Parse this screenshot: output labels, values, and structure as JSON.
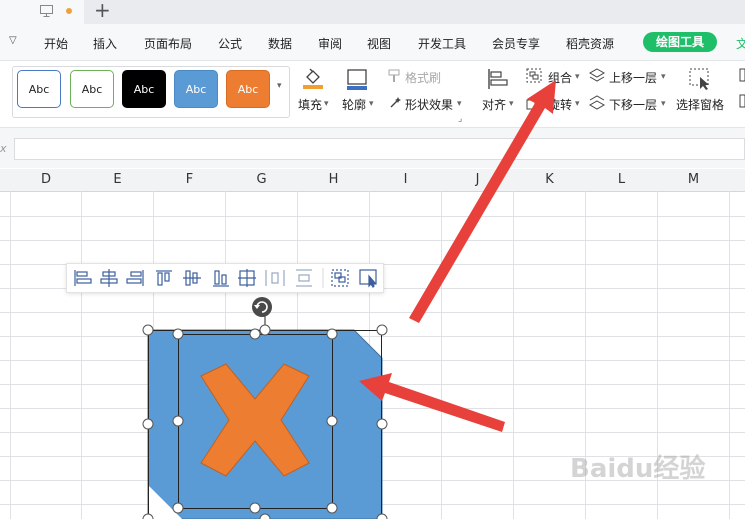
{
  "tabbar": {
    "add_symbol": "+"
  },
  "menu": {
    "tabs": [
      "开始",
      "插入",
      "页面布局",
      "公式",
      "数据",
      "审阅",
      "视图",
      "开发工具",
      "会员专享",
      "稻壳资源"
    ],
    "active_tab": "绘图工具",
    "next_tab_partial": "文"
  },
  "ribbon": {
    "shape_styles": [
      {
        "label": "Abc",
        "fill": "#ffffff",
        "border": "#4a78c2",
        "text": "#222222"
      },
      {
        "label": "Abc",
        "fill": "#ffffff",
        "border": "#6fb05a",
        "text": "#222222"
      },
      {
        "label": "Abc",
        "fill": "#000000",
        "border": "#000000",
        "text": "#ffffff"
      },
      {
        "label": "Abc",
        "fill": "#5b9bd5",
        "border": "#4a8ac4",
        "text": "#ffffff"
      },
      {
        "label": "Abc",
        "fill": "#ed7d31",
        "border": "#d86b22",
        "text": "#ffffff"
      }
    ],
    "fill": "填充",
    "outline": "轮廓",
    "format_painter": "格式刷",
    "shape_effects": "形状效果",
    "align": "对齐",
    "group": "组合",
    "rotate": "旋转",
    "bring_forward": "上移一层",
    "send_backward": "下移一层",
    "selection_pane": "选择窗格"
  },
  "sheet": {
    "columns": [
      "D",
      "E",
      "F",
      "G",
      "H",
      "I",
      "J",
      "K",
      "L",
      "M"
    ]
  },
  "float_toolbar": {
    "icons": [
      "align-left-icon",
      "align-center-horizontal-icon",
      "align-right-icon",
      "align-top-icon",
      "align-middle-icon",
      "align-bottom-icon",
      "align-center-icon",
      "distribute-horizontal-icon",
      "distribute-vertical-icon",
      "group-icon",
      "select-icon"
    ]
  },
  "colors": {
    "accent_green": "#1fbf6a",
    "shape_blue": "#5b9bd5",
    "shape_orange": "#ed7d31",
    "annotation_red": "#e8403a"
  },
  "watermark": "Baidu经验"
}
